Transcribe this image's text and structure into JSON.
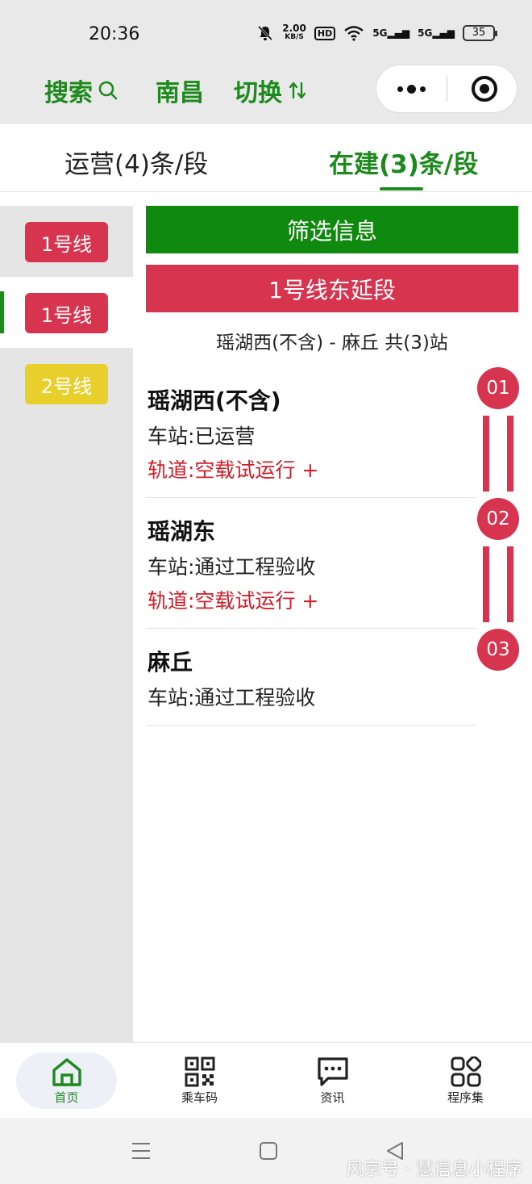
{
  "status_bar": {
    "time": "20:36",
    "speed_value": "2.00",
    "speed_unit": "KB/S",
    "hd_label": "HD",
    "signal1_label": "5G",
    "signal2_label": "5G",
    "battery": "35",
    "icons": [
      "mute-bell-icon",
      "wifi-icon",
      "signal-icon",
      "signal-icon",
      "battery-icon"
    ]
  },
  "navbar": {
    "search_label": "搜索",
    "city_label": "南昌",
    "switch_label": "切换"
  },
  "tabs": {
    "operating_label": "运营(4)条/段",
    "building_label": "在建(3)条/段"
  },
  "sidebar": {
    "items": [
      {
        "label": "1号线",
        "color": "#d6344f",
        "active": false
      },
      {
        "label": "1号线",
        "color": "#d6344f",
        "active": true
      },
      {
        "label": "2号线",
        "color": "#e9cf2c",
        "active": false
      }
    ]
  },
  "main": {
    "filter_label": "筛选信息",
    "segment_title": "1号线东延段",
    "segment_range": "瑶湖西(不含) - 麻丘 共(3)站",
    "stations": [
      {
        "index": "01",
        "name": "瑶湖西(不含)",
        "status": "车站:已运营",
        "track": "轨道:空载试运行 +"
      },
      {
        "index": "02",
        "name": "瑶湖东",
        "status": "车站:通过工程验收",
        "track": "轨道:空载试运行 +"
      },
      {
        "index": "03",
        "name": "麻丘",
        "status": "车站:通过工程验收"
      }
    ]
  },
  "tabbar": {
    "items": [
      {
        "label": "首页",
        "icon": "home-icon",
        "active": true
      },
      {
        "label": "乘车码",
        "icon": "qr-code-icon",
        "active": false
      },
      {
        "label": "资讯",
        "icon": "message-icon",
        "active": false
      },
      {
        "label": "程序集",
        "icon": "apps-grid-icon",
        "active": false
      }
    ]
  },
  "watermark": "风宗号 · 慧信息小程序",
  "colors": {
    "brand_green": "#1e8a1e",
    "line1_red": "#d6344f",
    "line2_yellow": "#e9cf2c",
    "track_text_red": "#d11c2a"
  }
}
